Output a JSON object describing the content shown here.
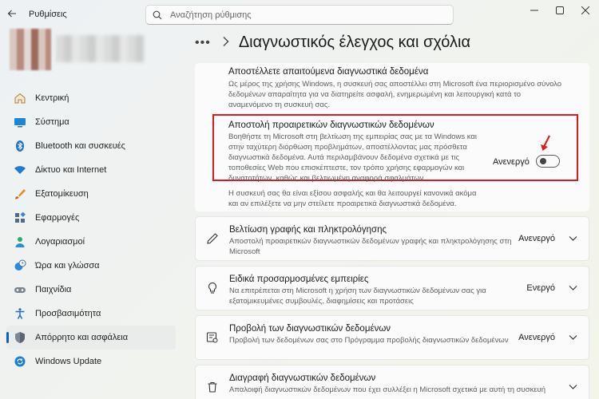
{
  "app": {
    "title": "Ρυθμίσεις"
  },
  "search": {
    "placeholder": "Αναζήτηση ρύθμισης"
  },
  "sidebar": {
    "items": [
      {
        "label": "Κεντρική",
        "icon": "home-icon"
      },
      {
        "label": "Σύστημα",
        "icon": "monitor-icon"
      },
      {
        "label": "Bluetooth και συσκευές",
        "icon": "bluetooth-icon"
      },
      {
        "label": "Δίκτυο και Internet",
        "icon": "wifi-icon"
      },
      {
        "label": "Εξατομίκευση",
        "icon": "brush-icon"
      },
      {
        "label": "Εφαρμογές",
        "icon": "apps-icon"
      },
      {
        "label": "Λογαριασμοί",
        "icon": "person-icon"
      },
      {
        "label": "Ώρα και γλώσσα",
        "icon": "clock-globe-icon"
      },
      {
        "label": "Παιχνίδια",
        "icon": "gamepad-icon"
      },
      {
        "label": "Προσβασιμότητα",
        "icon": "accessibility-icon"
      },
      {
        "label": "Απόρρητο και ασφάλεια",
        "icon": "shield-icon",
        "active": true
      },
      {
        "label": "Windows Update",
        "icon": "update-icon"
      }
    ]
  },
  "header": {
    "dots": "•••",
    "title": "Διαγνωστικός έλεγχος και σχόλια"
  },
  "required": {
    "title": "Αποστέλλετε απαιτούμενα διαγνωστικά δεδομένα",
    "desc_lines": [
      "Ως μέρος της χρήσης Windows, η συσκευή σας αποστέλλει στη Microsoft ένα περιορισμένο σύνολο",
      "δεδομένων απαραίτητα για να διατηρείτε ασφαλή, ενημερωμένη και λειτουργική κατά το",
      "αναμενόμενο τη συσκευή σας."
    ]
  },
  "optional": {
    "title": "Αποστολή προαιρετικών διαγνωστικών δεδομένων",
    "desc_lines": [
      "Βοηθήστε τη Microsoft στη βελτίωση της εμπειρίας σας με τα Windows και",
      "στην ταχύτερη διόρθωση προβλημάτων, αποστέλλοντας μας πρόσθετα",
      "διαγνωστικά δεδομένα. Αυτά περιλαμβάνουν δεδομένα σχετικά με τις",
      "τοποθεσίες Web που επισκέπτεστε, τον τρόπο χρήσης εφαρμογών και",
      "δυνατοτήτων, καθώς και βελτιωμένη αναφορά σφαλμάτων."
    ],
    "toggle_label": "Ανενεργό",
    "toggle_on": false,
    "footnote_lines": [
      "Η συσκευή σας θα είναι εξίσου ασφαλής και θα λειτουργεί κανονικά ακόμα",
      "και αν επιλέξετε να μην στείλετε προαιρετικά διαγνωστικά δεδομένα."
    ]
  },
  "rows": [
    {
      "title": "Βελτίωση γραφής και πληκτρολόγησης",
      "desc": "Αποστολή προαιρετικών διαγνωστικών δεδομένων γραφής και πληκτρολόγησης στη Microsoft",
      "value": "Ανενεργό",
      "icon": "pen-icon"
    },
    {
      "title": "Ειδικά προσαρμοσμένες εμπειρίες",
      "desc": "Να επιτρέπεται στη Microsoft η χρήση των διαγνωστικών δεδομένων σας για εξατομικευμένες συμβουλές, διαφημίσεις και προτάσεις",
      "value": "Ενεργό",
      "icon": "lightbulb-icon"
    },
    {
      "title": "Προβολή των διαγνωστικών δεδομένων",
      "desc": "Προβολή των δεδομένων σας στο Πρόγραμμα προβολής διαγνωστικών δεδομένων",
      "value": "Ανενεργό",
      "icon": "data-viewer-icon"
    },
    {
      "title": "Διαγραφή διαγνωστικών δεδομένων",
      "desc": "Απαλοιφή διαγνωστικών δεδομένων που έχει συλλέξει η Microsoft σχετικά με αυτή τη συσκευή",
      "value": "",
      "icon": "trash-icon"
    }
  ]
}
